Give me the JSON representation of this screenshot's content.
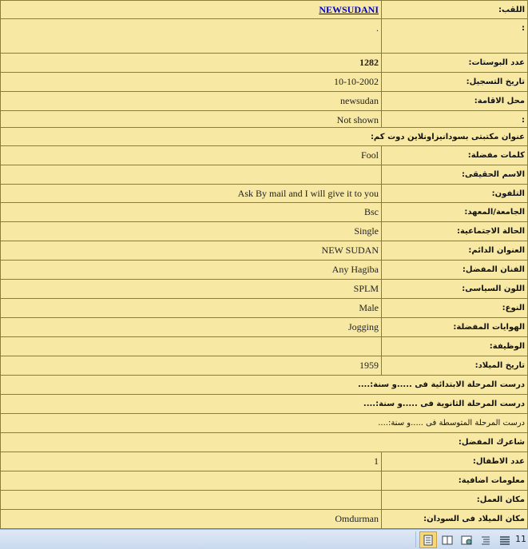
{
  "profile": {
    "title_label": "اللقب:",
    "title_value": "NEWSUDANI",
    "row2_label": ":",
    "row2_value": ".",
    "posts_label": "عدد البوستات:",
    "posts_value": "1282",
    "registered_label": "تاريخ التسجيل:",
    "registered_value": "10-10-2002",
    "residence_label": "محل الاقامة:",
    "residence_value": "newsudan",
    "row6_label": ":",
    "row6_value": "Not shown",
    "library_label": "عنوان مكتبتى بسودانيزاونلاين دوت كم:",
    "words_label": "كلمات مفضلة:",
    "words_value": "Fool",
    "realname_label": "الاسم الحقيقى:",
    "realname_value": "",
    "phone_label": "التلفون:",
    "phone_value": "Ask By mail and I will give it to you",
    "university_label": "الجامعة/المعهد:",
    "university_value": "Bsc",
    "marital_label": "الحالة الاجتماعية:",
    "marital_value": "Single",
    "address_label": "العنوان الدائم:",
    "address_value": "NEW SUDAN",
    "artist_label": "الفنان المفضل:",
    "artist_value": "Any Hagiba",
    "politics_label": "اللون السياسى:",
    "politics_value": "SPLM",
    "gender_label": "النوع:",
    "gender_value": "Male",
    "hobbies_label": "الهوايات المفضلة:",
    "hobbies_value": "Jogging",
    "job_label": "الوظيفة:",
    "job_value": "",
    "birth_label": "تاريخ الميلاد:",
    "birth_value": "1959",
    "primary_label": "درست المرحلة الابتدائية فى .....و سنة:....",
    "secondary_label": "درست المرحلة الثانوية فى .....و سنة:....",
    "intermediate_label": "درست المرحلة المتوسطة فى .....و سنة:....",
    "poet_label": "شاعرك المفضل:",
    "children_label": "عدد الاطفال:",
    "children_value": "1",
    "extra_label": "معلومات اضافية:",
    "extra_value": "",
    "workplace_label": "مكان العمل:",
    "workplace_value": "",
    "birthplace_label": "مكان الميلاد فى السودان:",
    "birthplace_value": "Omdurman"
  },
  "statusbar": {
    "page_number": "11",
    "icons": [
      "print-layout-view-icon",
      "full-screen-reading-icon",
      "web-layout-icon",
      "outline-view-icon",
      "draft-view-icon"
    ]
  }
}
